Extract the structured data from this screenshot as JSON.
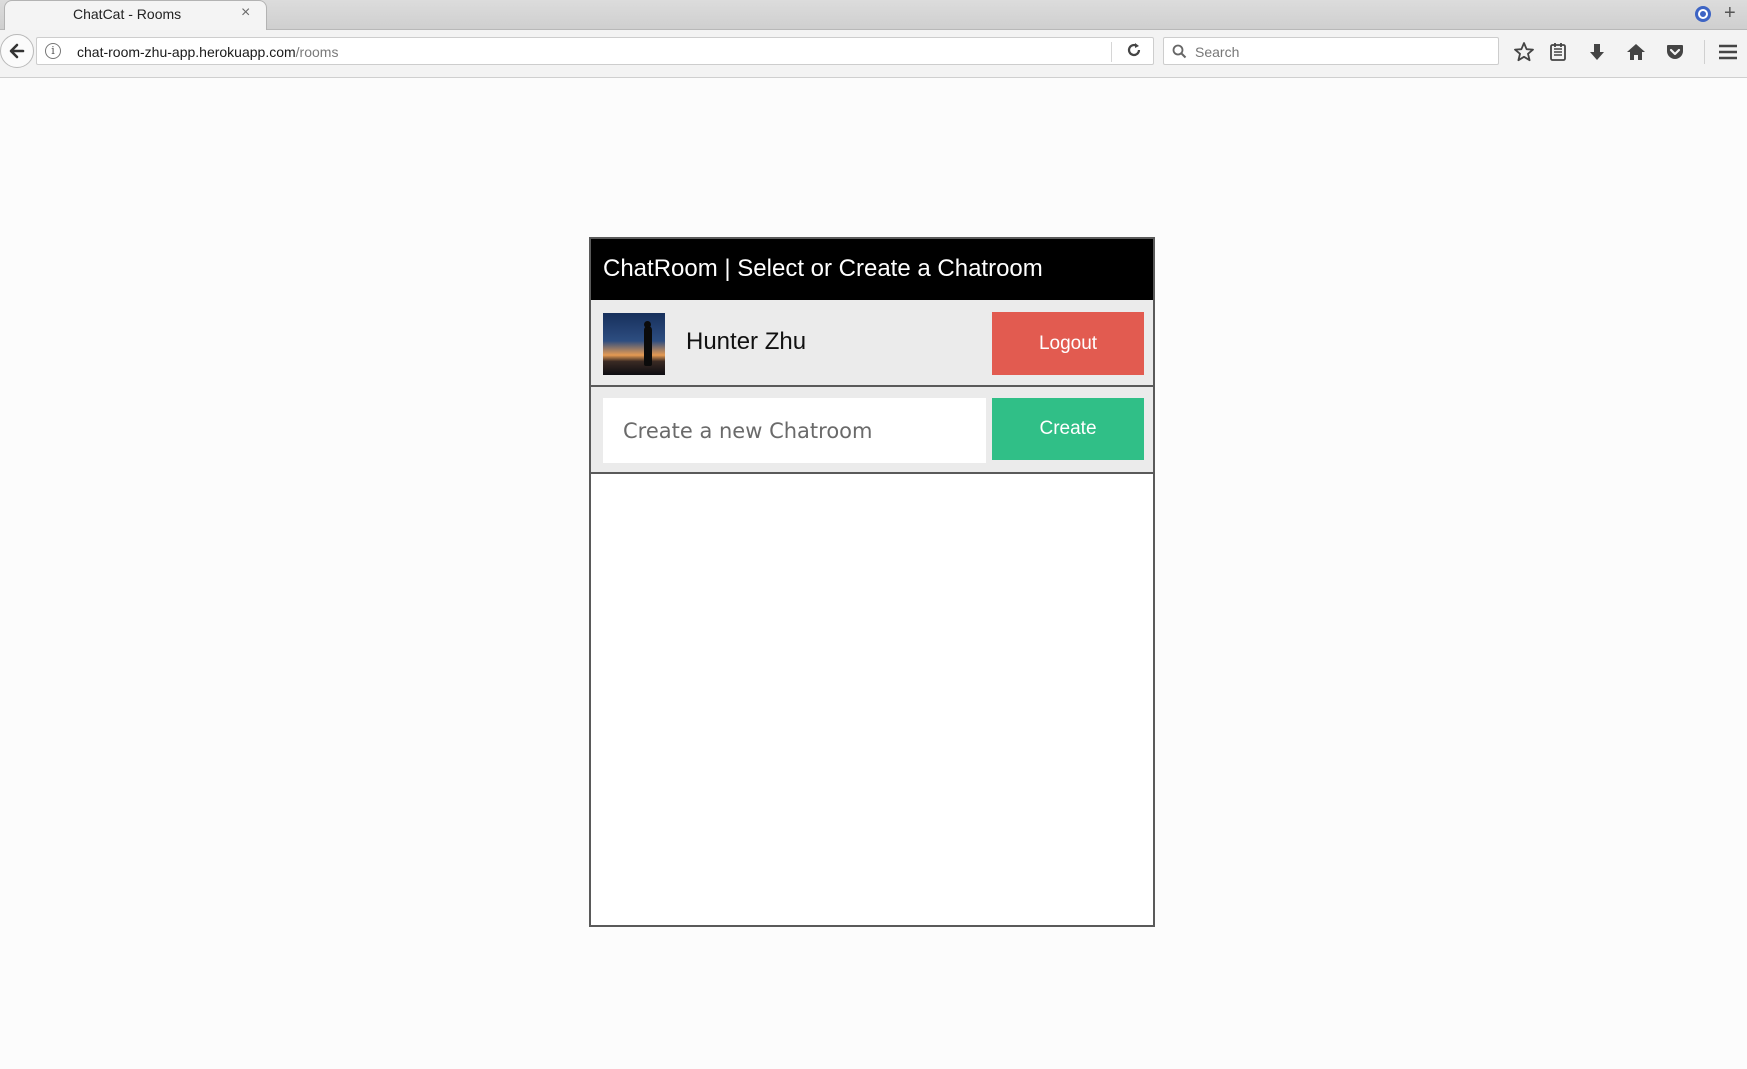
{
  "browser": {
    "tab_title": "ChatCat - Rooms",
    "tab_close": "×",
    "url_host": "chat-room-zhu-app.herokuapp.com",
    "url_path": "/rooms",
    "search_placeholder": "Search",
    "new_tab": "+"
  },
  "app": {
    "header_title": "ChatRoom | Select or Create a Chatroom",
    "user_name": "Hunter Zhu",
    "logout_label": "Logout",
    "create_placeholder": "Create a new Chatroom",
    "create_value": "",
    "create_label": "Create",
    "rooms": []
  },
  "colors": {
    "header_bg": "#000000",
    "logout_bg": "#e25b50",
    "create_bg": "#30bf87",
    "row_bg": "#ebebeb"
  }
}
